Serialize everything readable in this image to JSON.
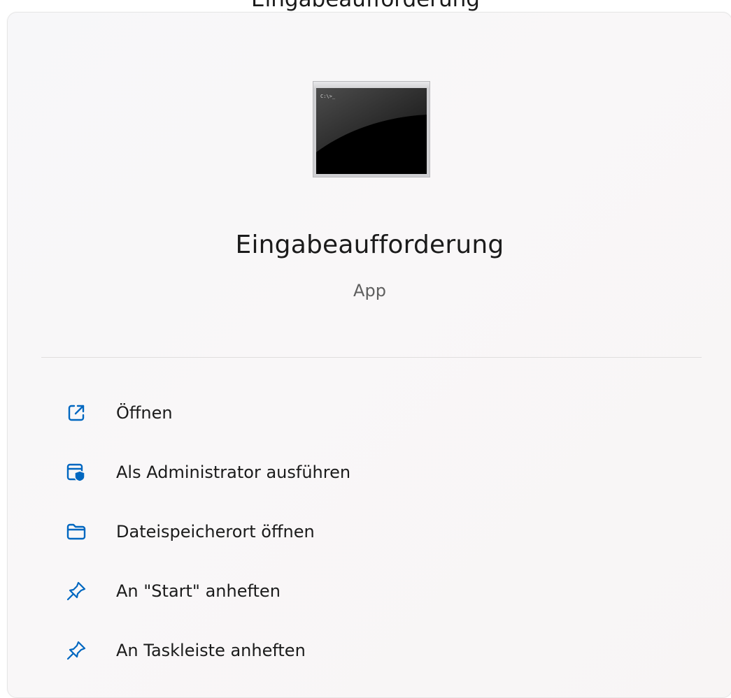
{
  "app": {
    "name": "Eingabeaufforderung",
    "type": "App",
    "clipped_header": "Eingabeaufforderung"
  },
  "actions": [
    {
      "label": "Öffnen",
      "icon": "open-external-icon"
    },
    {
      "label": "Als Administrator ausführen",
      "icon": "run-as-admin-shield-icon"
    },
    {
      "label": "Dateispeicherort öffnen",
      "icon": "folder-icon"
    },
    {
      "label": "An \"Start\" anheften",
      "icon": "pin-icon"
    },
    {
      "label": "An Taskleiste anheften",
      "icon": "pin-icon"
    }
  ],
  "colors": {
    "accent": "#0067c0",
    "text": "#1b1b1b",
    "subtext": "#5f5f5f"
  }
}
